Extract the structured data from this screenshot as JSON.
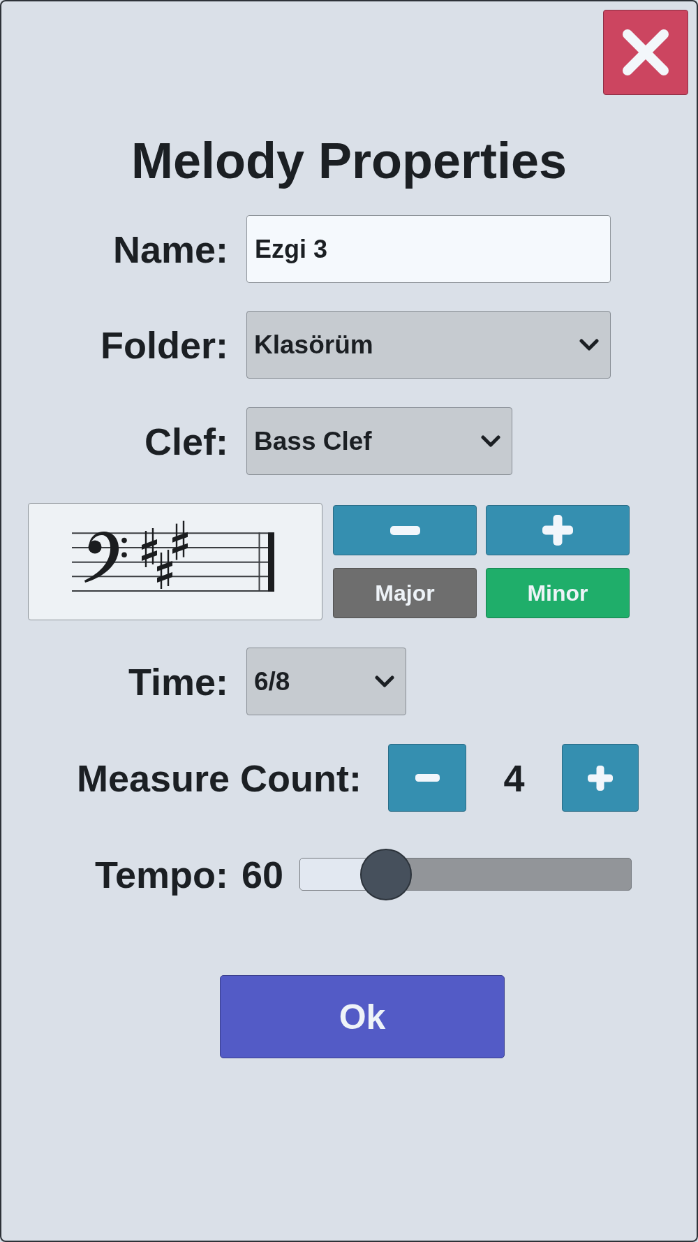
{
  "dialog": {
    "title": "Melody Properties"
  },
  "fields": [
    {
      "kind": "text",
      "label": "Name:",
      "value": "Ezgi 3"
    },
    {
      "kind": "select",
      "label": "Folder:",
      "value": "Klasörüm"
    },
    {
      "kind": "select",
      "label": "Clef:",
      "value": "Bass Clef"
    }
  ],
  "key_signature": {
    "symbols": [
      {
        "kind": "bass_clef"
      },
      {
        "kind": "sharp"
      },
      {
        "kind": "sharp"
      },
      {
        "kind": "sharp"
      }
    ],
    "mode_buttons": [
      {
        "label": "Major",
        "selected": false
      },
      {
        "label": "Minor",
        "selected": true
      }
    ]
  },
  "time": {
    "label": "Time:",
    "value": "6/8"
  },
  "measure_count": {
    "label": "Measure Count:",
    "value": "4"
  },
  "tempo": {
    "label": "Tempo:",
    "value": "60",
    "level": 0.26
  },
  "ok_button": {
    "label": "Ok"
  }
}
